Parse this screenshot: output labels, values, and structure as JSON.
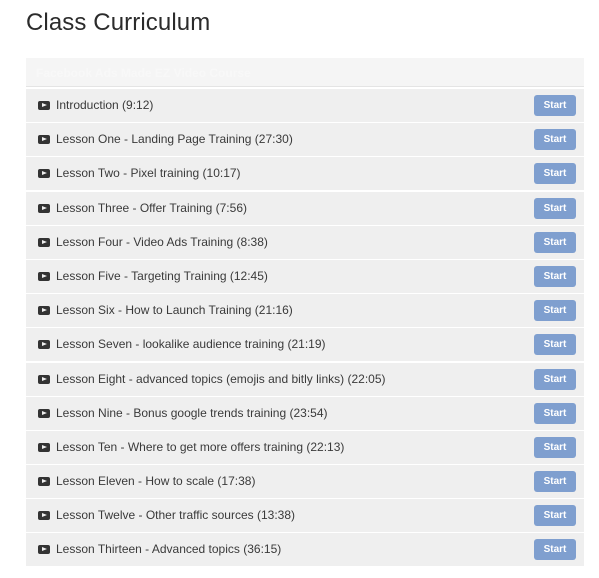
{
  "page": {
    "title": "Class Curriculum"
  },
  "section": {
    "title": "Facebook Ads Made EZ Video Course"
  },
  "lessons": [
    {
      "label": "Introduction (9:12)",
      "button": "Start",
      "icon": "play-icon"
    },
    {
      "label": "Lesson One - Landing Page Training (27:30)",
      "button": "Start",
      "icon": "play-icon"
    },
    {
      "label": "Lesson Two - Pixel training (10:17)",
      "button": "Start",
      "icon": "play-icon"
    },
    {
      "label": "Lesson Three - Offer Training (7:56)",
      "button": "Start",
      "icon": "play-icon"
    },
    {
      "label": "Lesson Four - Video Ads Training (8:38)",
      "button": "Start",
      "icon": "play-icon"
    },
    {
      "label": "Lesson Five - Targeting Training (12:45)",
      "button": "Start",
      "icon": "play-icon"
    },
    {
      "label": "Lesson Six - How to Launch Training (21:16)",
      "button": "Start",
      "icon": "play-icon"
    },
    {
      "label": "Lesson Seven - lookalike audience training (21:19)",
      "button": "Start",
      "icon": "play-icon"
    },
    {
      "label": "Lesson Eight - advanced topics (emojis and bitly links) (22:05)",
      "button": "Start",
      "icon": "play-icon"
    },
    {
      "label": "Lesson Nine - Bonus google trends training (23:54)",
      "button": "Start",
      "icon": "play-icon"
    },
    {
      "label": "Lesson Ten - Where to get more offers training (22:13)",
      "button": "Start",
      "icon": "play-icon"
    },
    {
      "label": "Lesson Eleven - How to scale (17:38)",
      "button": "Start",
      "icon": "play-icon"
    },
    {
      "label": "Lesson Twelve - Other traffic sources (13:38)",
      "button": "Start",
      "icon": "play-icon"
    },
    {
      "label": "Lesson Thirteen - Advanced topics (36:15)",
      "button": "Start",
      "icon": "play-icon"
    }
  ],
  "colors": {
    "button_bg": "#7f9fcf",
    "row_bg": "#efefef",
    "title_text": "#2b2b2b"
  }
}
